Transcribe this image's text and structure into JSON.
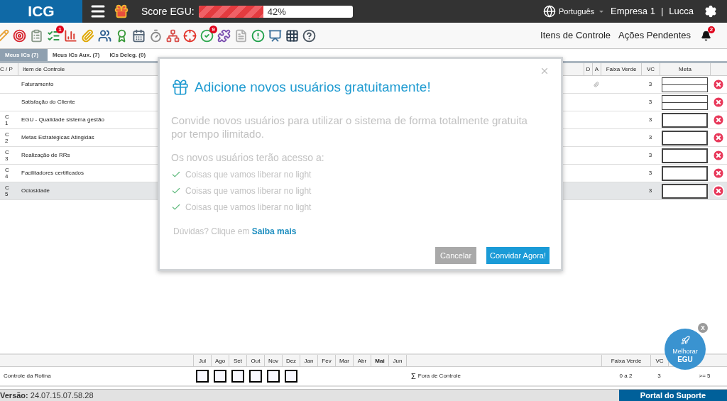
{
  "header": {
    "logo": "ICG",
    "score_label": "Score EGU:",
    "score": {
      "level": 0.42,
      "reading": "42%"
    },
    "language": "Português",
    "company": "Empresa 1",
    "separator": "|",
    "user": "Lucca"
  },
  "toolbar": [
    {
      "kind": "pencil"
    },
    {
      "kind": "target"
    },
    {
      "kind": "clipboard"
    },
    {
      "kind": "list",
      "badge": "1"
    },
    {
      "kind": "chart"
    },
    {
      "kind": "clip"
    },
    {
      "kind": "people"
    },
    {
      "kind": "medal"
    },
    {
      "kind": "calendar"
    },
    {
      "kind": "timer"
    },
    {
      "kind": "org"
    },
    {
      "kind": "crosshair"
    },
    {
      "kind": "check",
      "badge": "9"
    },
    {
      "kind": "puzzle"
    },
    {
      "kind": "pdf"
    },
    {
      "kind": "alert"
    },
    {
      "kind": "board"
    },
    {
      "kind": "grid"
    },
    {
      "kind": "help"
    }
  ],
  "nav_links": [
    "Itens de Controle",
    "Ações Pendentes"
  ],
  "notifications": {
    "badge": "2"
  },
  "tabs": [
    {
      "label": "Meus ICs (7)",
      "selected": true
    },
    {
      "label": "Meus ICs Aux. (7)",
      "selected": false
    },
    {
      "label": "ICs Deleg. (0)",
      "selected": false
    }
  ],
  "table": {
    "columns": [
      "C / P",
      "Item de Controle",
      "D",
      "A",
      "Faixa Verde",
      "VC",
      "Meta"
    ],
    "rows": [
      {
        "cp": [],
        "item": "Faturamento",
        "attachment": true,
        "vc": "3",
        "kind": "split",
        "selected": false
      },
      {
        "cp": [],
        "item": "Satisfação do Cliente",
        "attachment": false,
        "vc": "3",
        "kind": "split",
        "selected": false
      },
      {
        "cp": [
          "C",
          "1"
        ],
        "item": "EGU - Qualidade sistema gestão",
        "attachment": false,
        "vc": "3",
        "kind": "single",
        "selected": false
      },
      {
        "cp": [
          "C",
          "2"
        ],
        "item": "Metas Estratégicas Atingidas",
        "attachment": false,
        "vc": "3",
        "kind": "single",
        "selected": false
      },
      {
        "cp": [
          "C",
          "3"
        ],
        "item": "Realização de RRs",
        "attachment": false,
        "vc": "3",
        "kind": "single",
        "selected": false
      },
      {
        "cp": [
          "C",
          "4"
        ],
        "item": "Facilitadores certificados",
        "attachment": false,
        "vc": "3",
        "kind": "single",
        "selected": false
      },
      {
        "cp": [
          "C",
          "5"
        ],
        "item": "Ociosidade",
        "attachment": false,
        "vc": "3",
        "kind": "single",
        "selected": true
      }
    ]
  },
  "modal": {
    "title": "Adicione novos usuários gratuitamente!",
    "body": "Convide novos usuários para utilizar o sistema de forma totalmente gratuita por tempo ilimitado.",
    "access_heading": "Os novos usuários terão acesso a:",
    "items": [
      "Coisas que vamos liberar no light",
      "Coisas que vamos liberar no light",
      "Coisas que vamos liberar no light"
    ],
    "help_prefix": "Dúvidas? Clique em",
    "help_link": "Saiba mais",
    "cancel": "Cancelar",
    "confirm": "Convidar Agora!"
  },
  "routine": {
    "months": [
      {
        "label": "Jul",
        "selected": false,
        "kind": "entry"
      },
      {
        "label": "Ago",
        "selected": false,
        "kind": "entry"
      },
      {
        "label": "Set",
        "selected": false,
        "kind": "entry"
      },
      {
        "label": "Out",
        "selected": false,
        "kind": "entry"
      },
      {
        "label": "Nov",
        "selected": false,
        "kind": "entry"
      },
      {
        "label": "Dez",
        "selected": false,
        "kind": "entry"
      },
      {
        "label": "Jan",
        "selected": false,
        "kind": "empty"
      },
      {
        "label": "Fev",
        "selected": false,
        "kind": "empty"
      },
      {
        "label": "Mar",
        "selected": false,
        "kind": "empty"
      },
      {
        "label": "Abr",
        "selected": false,
        "kind": "empty"
      },
      {
        "label": "Mai",
        "selected": true,
        "kind": "empty"
      },
      {
        "label": "Jun",
        "selected": false,
        "kind": "empty"
      }
    ],
    "columns": [
      "Faixa Verde",
      "VC"
    ],
    "row_label": "Controle da Rotina",
    "sum_symbol": "Σ",
    "sum_label": "Fora de Controle",
    "values": [
      "0 a 2",
      "3",
      ">= 5"
    ]
  },
  "footer": {
    "version_label": "Versão:",
    "version": "24.07.15.07.58.28",
    "support": "Portal do Suporte"
  },
  "fab": {
    "line1": "Melhorar",
    "line2": "EGU",
    "close": "x"
  }
}
